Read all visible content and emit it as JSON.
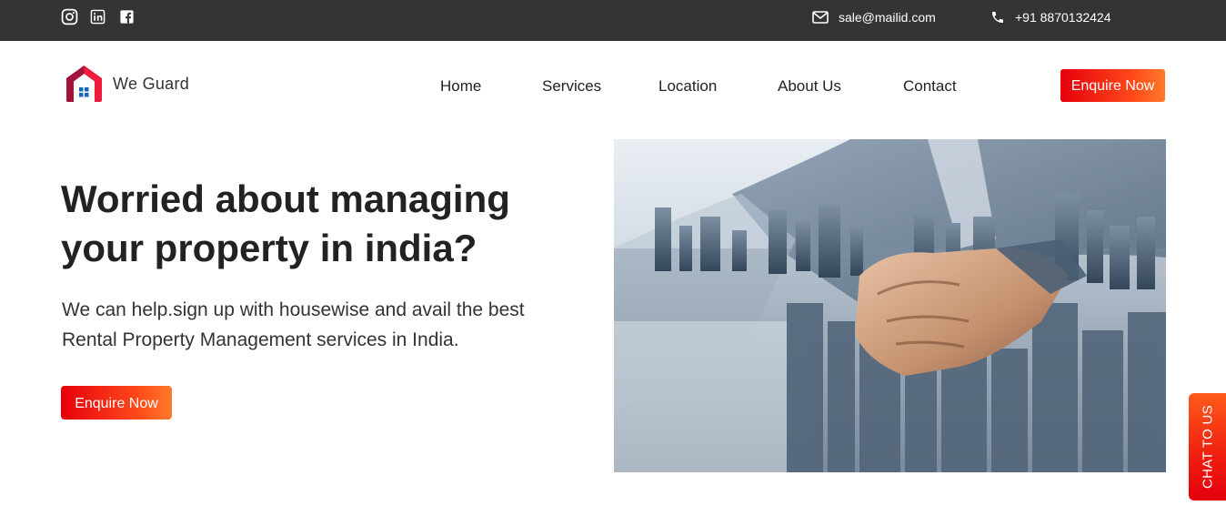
{
  "topbar": {
    "social": [
      {
        "icon": "instagram-icon"
      },
      {
        "icon": "linkedin-icon"
      },
      {
        "icon": "facebook-icon"
      }
    ],
    "email": "sale@mailid.com",
    "phone": "+91 8870132424"
  },
  "brand": {
    "name": "We Guard",
    "logo_colors": [
      "#ee1d3b",
      "#a3123a",
      "#1565c0"
    ]
  },
  "nav": {
    "items": [
      "Home",
      "Services",
      "Location",
      "About Us",
      "Contact"
    ],
    "cta": "Enquire Now"
  },
  "hero": {
    "title": "Worried about managing your property in india?",
    "subtitle": "We can help.sign up with housewise and avail the best Rental Property Management services in India.",
    "cta": "Enquire Now",
    "image": "handshake-city-image"
  },
  "chat": {
    "label": "CHAT TO US"
  },
  "colors": {
    "topbar_bg": "#343434",
    "accent_start": "#e6000c",
    "accent_end": "#ff7a2a",
    "text_dark": "#222222"
  }
}
